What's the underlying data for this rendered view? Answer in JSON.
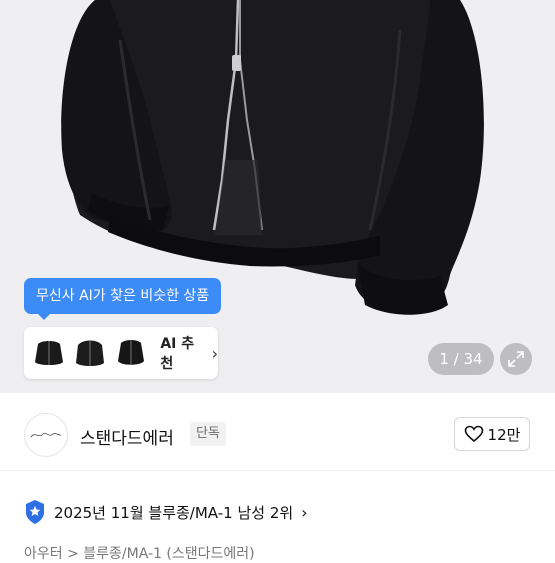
{
  "ai_recommend": {
    "tooltip": "무신사 AI가 찾은 비슷한 상품",
    "label": "AI 추천",
    "chevron_icon": "chevron-right-icon"
  },
  "gallery": {
    "pager": "1 / 34",
    "expand_icon": "expand-icon"
  },
  "brand": {
    "name": "스탠다드에러",
    "badge": "단독",
    "likes": "12만",
    "heart_icon": "heart-icon"
  },
  "ranking": {
    "text": "2025년 11월 블루종/MA-1 남성 2위",
    "badge_icon": "rank-badge-icon"
  },
  "breadcrumb": "아우터 > 블루종/MA-1 (스탠다드에러)",
  "colors": {
    "accent": "#3d8bf7",
    "hero_bg": "#efeff1"
  }
}
